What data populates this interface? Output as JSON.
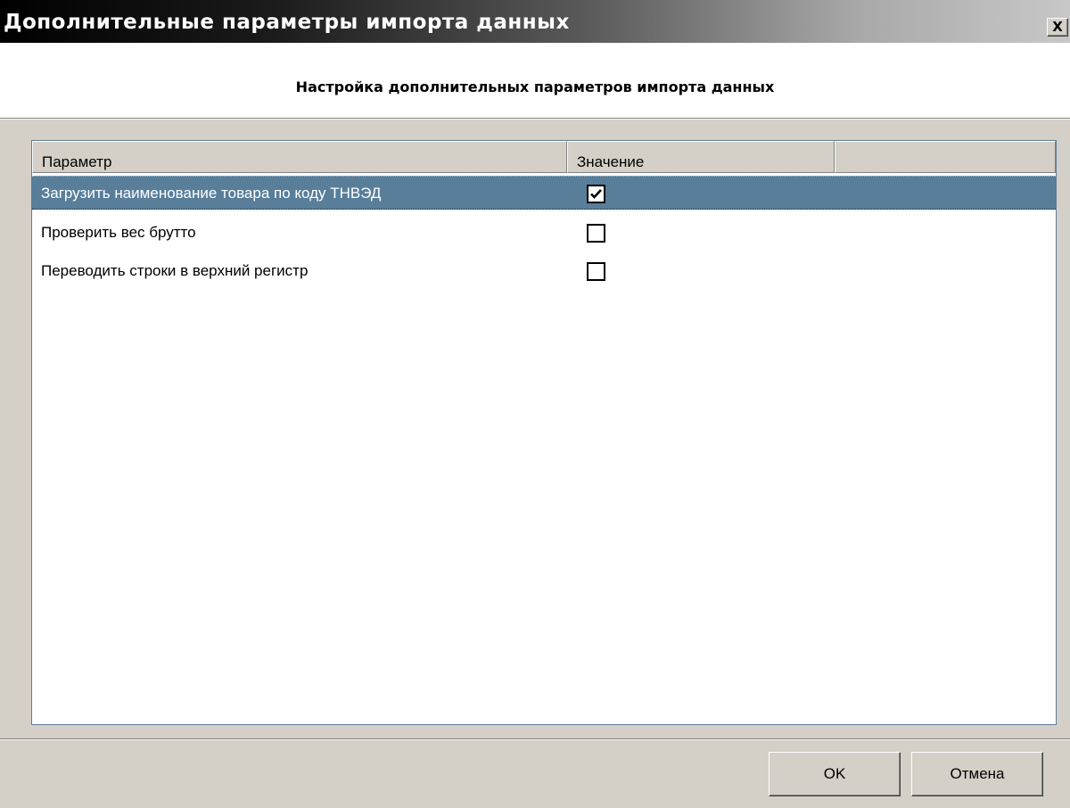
{
  "window": {
    "title": "Дополнительные параметры импорта данных",
    "close_label": "X"
  },
  "header": {
    "title": "Настройка дополнительных параметров импорта данных"
  },
  "grid": {
    "columns": [
      "Параметр",
      "Значение",
      ""
    ],
    "rows": [
      {
        "param": "Загрузить наименование товара по коду ТНВЭД",
        "checked": true,
        "selected": true
      },
      {
        "param": "Проверить вес брутто",
        "checked": false,
        "selected": false
      },
      {
        "param": "Переводить строки в верхний регистр",
        "checked": false,
        "selected": false
      }
    ]
  },
  "buttons": {
    "ok_label": "OK",
    "cancel_label": "Отмена"
  },
  "colors": {
    "selected_row": "#587e9a",
    "dialog_bg": "#d4d0c8"
  },
  "icons": {
    "close": "close-icon",
    "check": "checkmark-icon"
  }
}
